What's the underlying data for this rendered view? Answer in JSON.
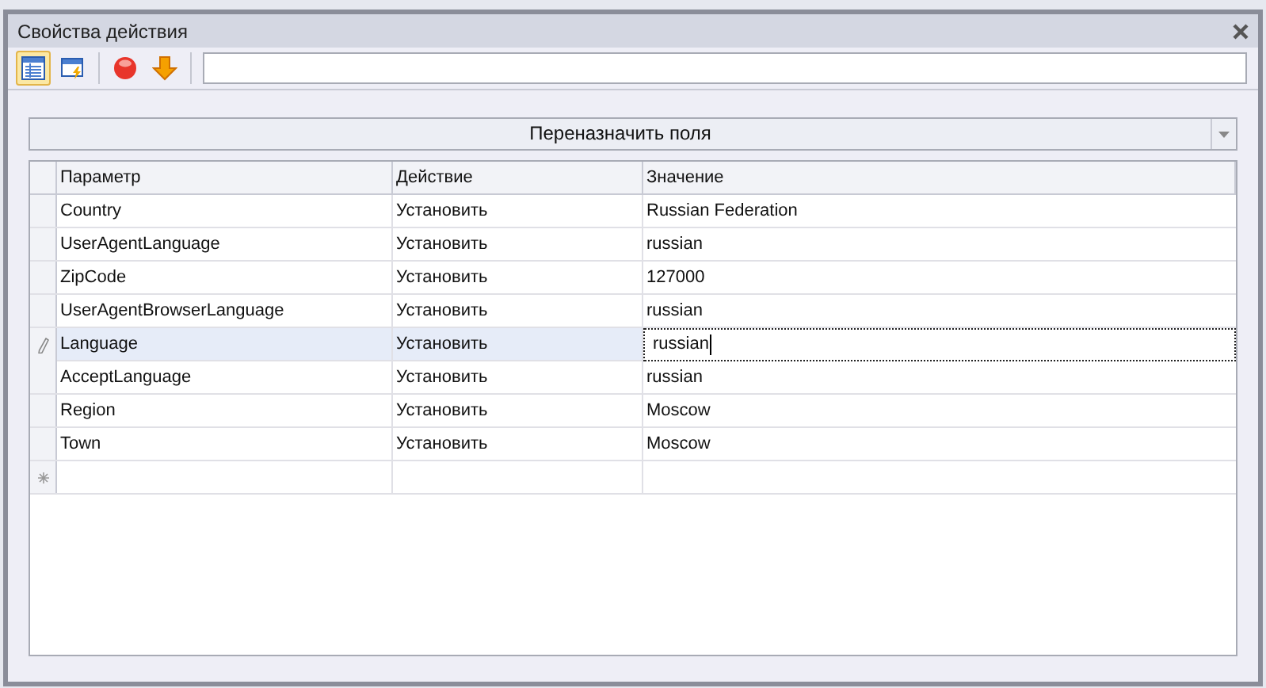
{
  "window": {
    "title": "Свойства действия"
  },
  "toolbar": [
    {
      "selected": true
    },
    {
      "selected": false
    },
    {
      "selected": false
    },
    {
      "selected": false
    }
  ],
  "mode_dropdown": {
    "value": "Переназначить поля"
  },
  "table": {
    "columns": [
      "Параметр",
      "Действие",
      "Значение"
    ],
    "rows": [
      {
        "cells": [
          "Country",
          "Установить",
          "Russian Federation"
        ],
        "selected": false
      },
      {
        "cells": [
          "UserAgentLanguage",
          "Установить",
          "russian"
        ],
        "selected": false
      },
      {
        "cells": [
          "ZipCode",
          "Установить",
          "127000"
        ],
        "selected": false
      },
      {
        "cells": [
          "UserAgentBrowserLanguage",
          "Установить",
          "russian"
        ],
        "selected": false
      },
      {
        "cells": [
          "Language",
          "Установить",
          "russian"
        ],
        "selected": true
      },
      {
        "cells": [
          "AcceptLanguage",
          "Установить",
          "russian"
        ],
        "selected": false
      },
      {
        "cells": [
          "Region",
          "Установить",
          "Moscow"
        ],
        "selected": false
      },
      {
        "cells": [
          "Town",
          "Установить",
          "Moscow"
        ],
        "selected": false
      }
    ]
  }
}
